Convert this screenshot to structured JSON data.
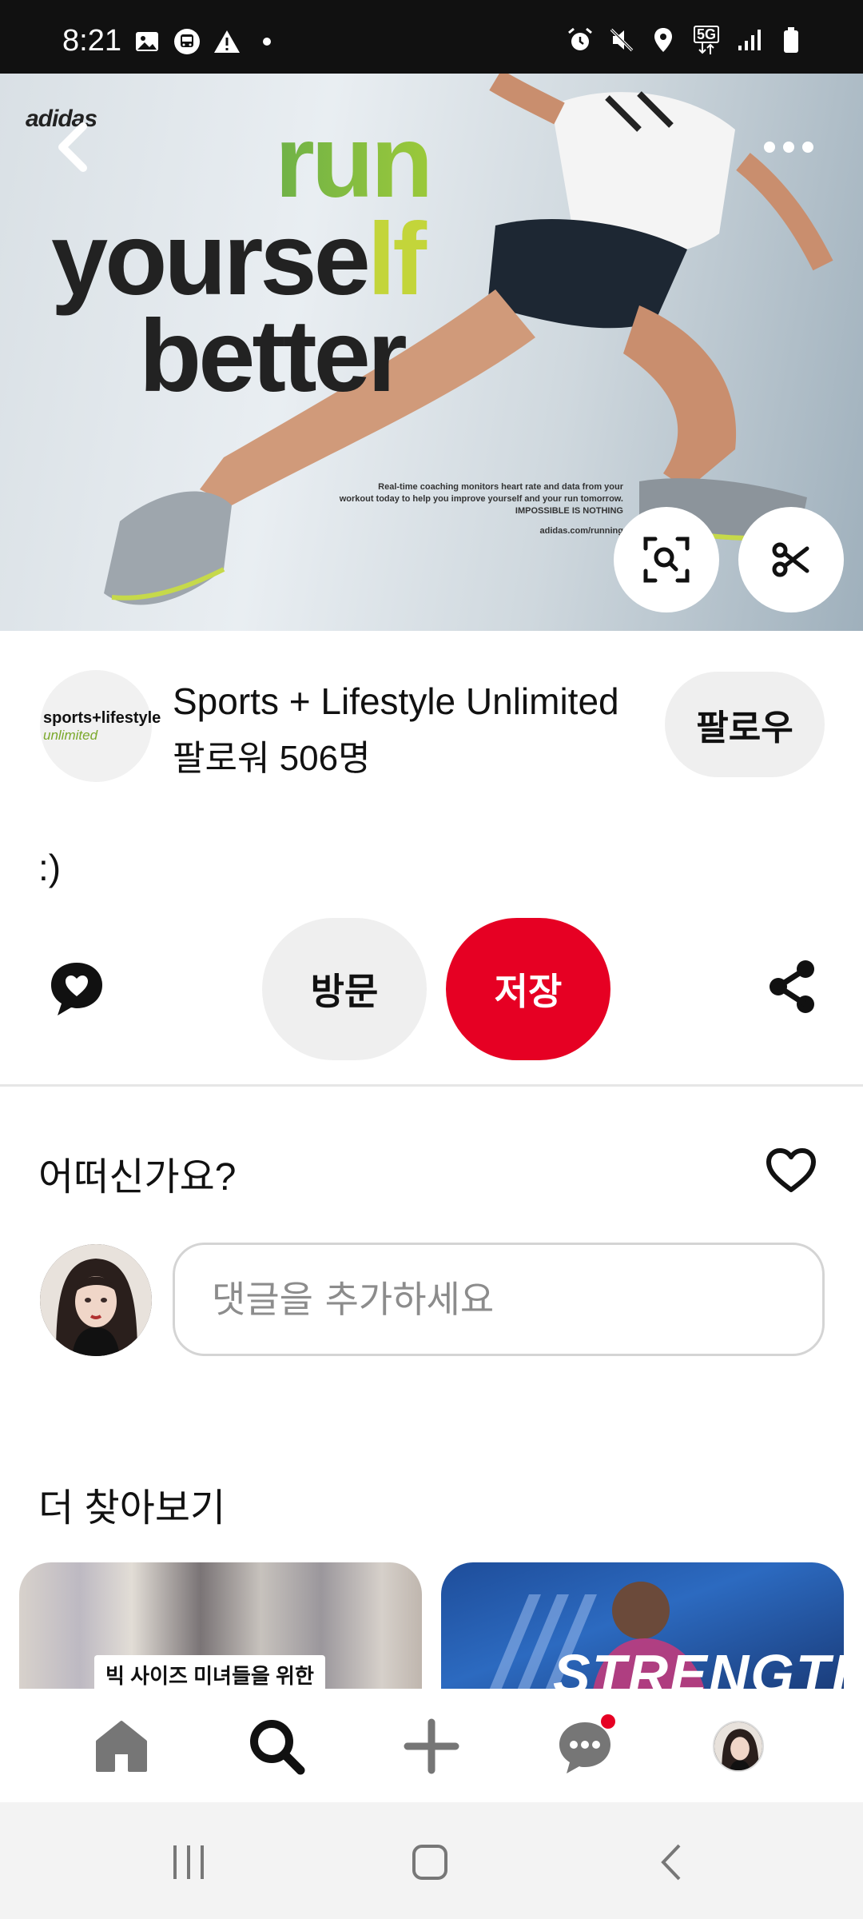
{
  "status_bar": {
    "time": "8:21",
    "left_icons": [
      "gallery-icon",
      "bus-icon",
      "warning-icon",
      "dot-icon"
    ],
    "right_icons": [
      "alarm-icon",
      "mute-icon",
      "location-icon",
      "5g-icon",
      "signal-icon",
      "battery-icon"
    ],
    "network_label": "5G"
  },
  "hero": {
    "brand_text": "adidas",
    "headline_line1": "run",
    "headline_line2_a": "yourse",
    "headline_line2_b": "lf",
    "headline_line3": "better",
    "small_print_1": "Real-time coaching monitors heart rate and data from your",
    "small_print_2": "workout today to help you improve yourself and your run tomorrow.",
    "small_print_3": "IMPOSSIBLE IS NOTHING",
    "small_url": "adidas.com/running"
  },
  "creator": {
    "logo_line1": "sports+lifestyle",
    "logo_line2": "unlimited",
    "name": "Sports + Lifestyle Unlimited",
    "followers": "팔로워 506명",
    "follow_label": "팔로우"
  },
  "description": ":)",
  "actions": {
    "visit_label": "방문",
    "save_label": "저장"
  },
  "comments": {
    "title": "어떠신가요?",
    "input_placeholder": "댓글을 추가하세요"
  },
  "more": {
    "title": "더 찾아보기",
    "pin1_label": "빅 사이즈 미녀들을 위한",
    "pin2_text": "STRENGTH"
  },
  "bottom_nav": {
    "items": [
      "home-icon",
      "search-icon",
      "create-icon",
      "messages-icon",
      "profile-avatar"
    ]
  },
  "colors": {
    "accent_red": "#e60023",
    "button_gray": "#efefef",
    "status_bar": "#111111"
  }
}
